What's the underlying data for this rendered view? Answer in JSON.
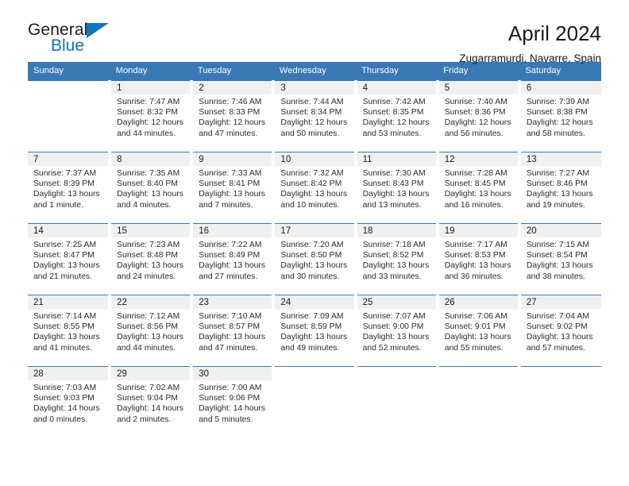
{
  "logo": {
    "word_top": "General",
    "word_bottom": "Blue",
    "accent_color": "#1175bc"
  },
  "header": {
    "title": "April 2024",
    "subtitle": "Zugarramurdi, Navarre, Spain"
  },
  "theme": {
    "header_blue": "#3878b4",
    "daynum_gray": "#f0f0f0",
    "text": "#1a1a1a"
  },
  "weekday_headers": [
    "Sunday",
    "Monday",
    "Tuesday",
    "Wednesday",
    "Thursday",
    "Friday",
    "Saturday"
  ],
  "labels": {
    "sunrise": "Sunrise:",
    "sunset": "Sunset:",
    "daylight": "Daylight:"
  },
  "weeks": [
    [
      {
        "day": "",
        "empty": true
      },
      {
        "day": "1",
        "sunrise": "Sunrise: 7:47 AM",
        "sunset": "Sunset: 8:32 PM",
        "daylight1": "Daylight: 12 hours",
        "daylight2": "and 44 minutes."
      },
      {
        "day": "2",
        "sunrise": "Sunrise: 7:46 AM",
        "sunset": "Sunset: 8:33 PM",
        "daylight1": "Daylight: 12 hours",
        "daylight2": "and 47 minutes."
      },
      {
        "day": "3",
        "sunrise": "Sunrise: 7:44 AM",
        "sunset": "Sunset: 8:34 PM",
        "daylight1": "Daylight: 12 hours",
        "daylight2": "and 50 minutes."
      },
      {
        "day": "4",
        "sunrise": "Sunrise: 7:42 AM",
        "sunset": "Sunset: 8:35 PM",
        "daylight1": "Daylight: 12 hours",
        "daylight2": "and 53 minutes."
      },
      {
        "day": "5",
        "sunrise": "Sunrise: 7:40 AM",
        "sunset": "Sunset: 8:36 PM",
        "daylight1": "Daylight: 12 hours",
        "daylight2": "and 56 minutes."
      },
      {
        "day": "6",
        "sunrise": "Sunrise: 7:39 AM",
        "sunset": "Sunset: 8:38 PM",
        "daylight1": "Daylight: 12 hours",
        "daylight2": "and 58 minutes."
      }
    ],
    [
      {
        "day": "7",
        "sunrise": "Sunrise: 7:37 AM",
        "sunset": "Sunset: 8:39 PM",
        "daylight1": "Daylight: 13 hours",
        "daylight2": "and 1 minute."
      },
      {
        "day": "8",
        "sunrise": "Sunrise: 7:35 AM",
        "sunset": "Sunset: 8:40 PM",
        "daylight1": "Daylight: 13 hours",
        "daylight2": "and 4 minutes."
      },
      {
        "day": "9",
        "sunrise": "Sunrise: 7:33 AM",
        "sunset": "Sunset: 8:41 PM",
        "daylight1": "Daylight: 13 hours",
        "daylight2": "and 7 minutes."
      },
      {
        "day": "10",
        "sunrise": "Sunrise: 7:32 AM",
        "sunset": "Sunset: 8:42 PM",
        "daylight1": "Daylight: 13 hours",
        "daylight2": "and 10 minutes."
      },
      {
        "day": "11",
        "sunrise": "Sunrise: 7:30 AM",
        "sunset": "Sunset: 8:43 PM",
        "daylight1": "Daylight: 13 hours",
        "daylight2": "and 13 minutes."
      },
      {
        "day": "12",
        "sunrise": "Sunrise: 7:28 AM",
        "sunset": "Sunset: 8:45 PM",
        "daylight1": "Daylight: 13 hours",
        "daylight2": "and 16 minutes."
      },
      {
        "day": "13",
        "sunrise": "Sunrise: 7:27 AM",
        "sunset": "Sunset: 8:46 PM",
        "daylight1": "Daylight: 13 hours",
        "daylight2": "and 19 minutes."
      }
    ],
    [
      {
        "day": "14",
        "sunrise": "Sunrise: 7:25 AM",
        "sunset": "Sunset: 8:47 PM",
        "daylight1": "Daylight: 13 hours",
        "daylight2": "and 21 minutes."
      },
      {
        "day": "15",
        "sunrise": "Sunrise: 7:23 AM",
        "sunset": "Sunset: 8:48 PM",
        "daylight1": "Daylight: 13 hours",
        "daylight2": "and 24 minutes."
      },
      {
        "day": "16",
        "sunrise": "Sunrise: 7:22 AM",
        "sunset": "Sunset: 8:49 PM",
        "daylight1": "Daylight: 13 hours",
        "daylight2": "and 27 minutes."
      },
      {
        "day": "17",
        "sunrise": "Sunrise: 7:20 AM",
        "sunset": "Sunset: 8:50 PM",
        "daylight1": "Daylight: 13 hours",
        "daylight2": "and 30 minutes."
      },
      {
        "day": "18",
        "sunrise": "Sunrise: 7:18 AM",
        "sunset": "Sunset: 8:52 PM",
        "daylight1": "Daylight: 13 hours",
        "daylight2": "and 33 minutes."
      },
      {
        "day": "19",
        "sunrise": "Sunrise: 7:17 AM",
        "sunset": "Sunset: 8:53 PM",
        "daylight1": "Daylight: 13 hours",
        "daylight2": "and 36 minutes."
      },
      {
        "day": "20",
        "sunrise": "Sunrise: 7:15 AM",
        "sunset": "Sunset: 8:54 PM",
        "daylight1": "Daylight: 13 hours",
        "daylight2": "and 38 minutes."
      }
    ],
    [
      {
        "day": "21",
        "sunrise": "Sunrise: 7:14 AM",
        "sunset": "Sunset: 8:55 PM",
        "daylight1": "Daylight: 13 hours",
        "daylight2": "and 41 minutes."
      },
      {
        "day": "22",
        "sunrise": "Sunrise: 7:12 AM",
        "sunset": "Sunset: 8:56 PM",
        "daylight1": "Daylight: 13 hours",
        "daylight2": "and 44 minutes."
      },
      {
        "day": "23",
        "sunrise": "Sunrise: 7:10 AM",
        "sunset": "Sunset: 8:57 PM",
        "daylight1": "Daylight: 13 hours",
        "daylight2": "and 47 minutes."
      },
      {
        "day": "24",
        "sunrise": "Sunrise: 7:09 AM",
        "sunset": "Sunset: 8:59 PM",
        "daylight1": "Daylight: 13 hours",
        "daylight2": "and 49 minutes."
      },
      {
        "day": "25",
        "sunrise": "Sunrise: 7:07 AM",
        "sunset": "Sunset: 9:00 PM",
        "daylight1": "Daylight: 13 hours",
        "daylight2": "and 52 minutes."
      },
      {
        "day": "26",
        "sunrise": "Sunrise: 7:06 AM",
        "sunset": "Sunset: 9:01 PM",
        "daylight1": "Daylight: 13 hours",
        "daylight2": "and 55 minutes."
      },
      {
        "day": "27",
        "sunrise": "Sunrise: 7:04 AM",
        "sunset": "Sunset: 9:02 PM",
        "daylight1": "Daylight: 13 hours",
        "daylight2": "and 57 minutes."
      }
    ],
    [
      {
        "day": "28",
        "sunrise": "Sunrise: 7:03 AM",
        "sunset": "Sunset: 9:03 PM",
        "daylight1": "Daylight: 14 hours",
        "daylight2": "and 0 minutes."
      },
      {
        "day": "29",
        "sunrise": "Sunrise: 7:02 AM",
        "sunset": "Sunset: 9:04 PM",
        "daylight1": "Daylight: 14 hours",
        "daylight2": "and 2 minutes."
      },
      {
        "day": "30",
        "sunrise": "Sunrise: 7:00 AM",
        "sunset": "Sunset: 9:06 PM",
        "daylight1": "Daylight: 14 hours",
        "daylight2": "and 5 minutes."
      },
      {
        "day": "",
        "empty": true
      },
      {
        "day": "",
        "empty": true
      },
      {
        "day": "",
        "empty": true
      },
      {
        "day": "",
        "empty": true
      }
    ]
  ]
}
